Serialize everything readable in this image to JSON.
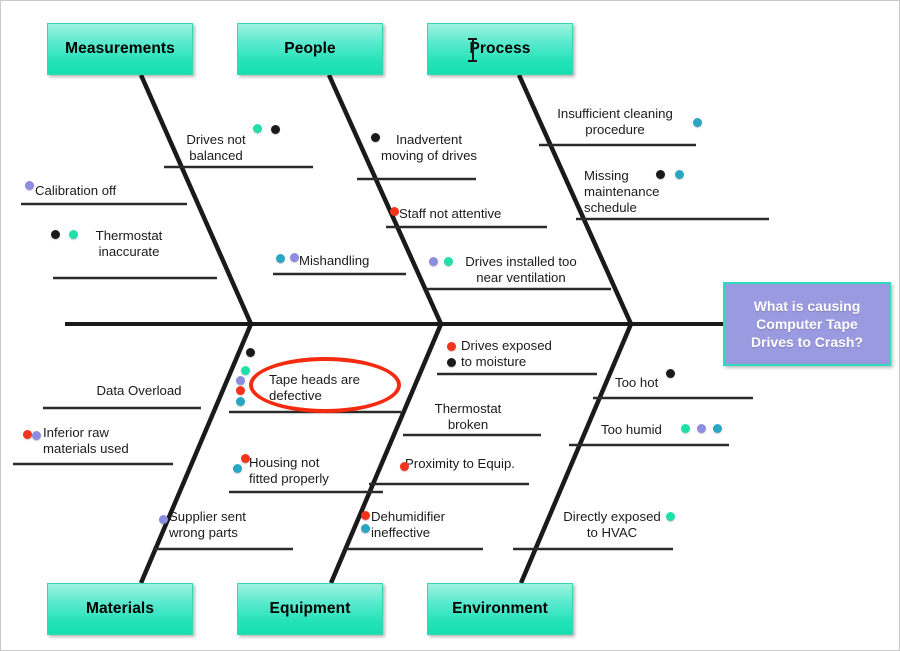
{
  "diagram": {
    "type": "fishbone-ishikawa",
    "effect": {
      "text": "What is causing Computer Tape Drives to Crash?",
      "line1": "What is causing",
      "line2": "Computer Tape",
      "line3": "Drives to Crash?",
      "fill": "#9a9ae0",
      "border": "#2fd9c0",
      "text_color": "#ffffff"
    },
    "category_box_style": {
      "fill_top": "#9df2de",
      "fill_bottom": "#18dfb2",
      "border": "#36d6b4",
      "text_color": "#000000"
    },
    "spine_color": "#1a1a1a",
    "highlight": {
      "shape": "ellipse",
      "color": "#f42b10",
      "target": "Tape heads are defective"
    },
    "cursor": {
      "type": "text-ibeam",
      "over": "Process"
    },
    "dot_palette": {
      "black": "#1a1a1a",
      "red": "#f4341a",
      "spring_green": "#1fe0a8",
      "teal": "#2aa5c4",
      "periwinkle": "#8c8ce0"
    },
    "categories": [
      {
        "id": "measurements",
        "label": "Measurements",
        "position": "top",
        "causes": [
          {
            "label": "Drives not\nbalanced",
            "dots": [
              "spring_green",
              "black"
            ]
          },
          {
            "label": "Calibration off",
            "dots": [
              "periwinkle"
            ]
          },
          {
            "label": "Thermostat\ninaccurate",
            "dots": [
              "black",
              "spring_green"
            ]
          }
        ]
      },
      {
        "id": "people",
        "label": "People",
        "position": "top",
        "causes": [
          {
            "label": "Inadvertent\nmoving of drives",
            "dots": [
              "black"
            ]
          },
          {
            "label": "Staff not attentive",
            "dots": [
              "red"
            ]
          },
          {
            "label": "Mishandling",
            "dots": [
              "teal",
              "periwinkle"
            ]
          }
        ]
      },
      {
        "id": "process",
        "label": "Process",
        "position": "top",
        "causes": [
          {
            "label": "Insufficient cleaning\nprocedure",
            "dots": [
              "teal"
            ]
          },
          {
            "label": "Missing\nmaintenance\nschedule",
            "dots": [
              "black",
              "teal"
            ]
          },
          {
            "label": "Drives installed too\nnear ventilation",
            "dots": [
              "periwinkle",
              "spring_green"
            ]
          }
        ]
      },
      {
        "id": "materials",
        "label": "Materials",
        "position": "bottom",
        "causes": [
          {
            "label": "Data Overload",
            "dots": []
          },
          {
            "label": "Inferior raw\nmaterials used",
            "dots": [
              "red",
              "periwinkle"
            ]
          },
          {
            "label": "Supplier sent\nwrong parts",
            "dots": [
              "periwinkle"
            ]
          }
        ]
      },
      {
        "id": "equipment",
        "label": "Equipment",
        "position": "bottom",
        "causes": [
          {
            "label": "Tape heads are\ndefective",
            "dots": [
              "black",
              "spring_green",
              "periwinkle",
              "red",
              "teal"
            ],
            "highlighted": true
          },
          {
            "label": "Housing not\nfitted properly",
            "dots": [
              "red",
              "teal"
            ]
          },
          {
            "label": "Dehumidifier\nineffective",
            "dots": [
              "red",
              "teal"
            ]
          }
        ]
      },
      {
        "id": "environment",
        "label": "Environment",
        "position": "bottom",
        "causes": [
          {
            "label": "Drives exposed\nto moisture",
            "dots": [
              "red",
              "black"
            ]
          },
          {
            "label": "Thermostat\nbroken",
            "dots": []
          },
          {
            "label": "Proximity to Equip.",
            "dots": [
              "red"
            ]
          },
          {
            "label": "Too hot",
            "dots": [
              "black"
            ]
          },
          {
            "label": "Too humid",
            "dots": [
              "spring_green",
              "periwinkle",
              "teal"
            ]
          },
          {
            "label": "Directly exposed\nto HVAC",
            "dots": [
              "spring_green"
            ]
          }
        ]
      }
    ]
  }
}
